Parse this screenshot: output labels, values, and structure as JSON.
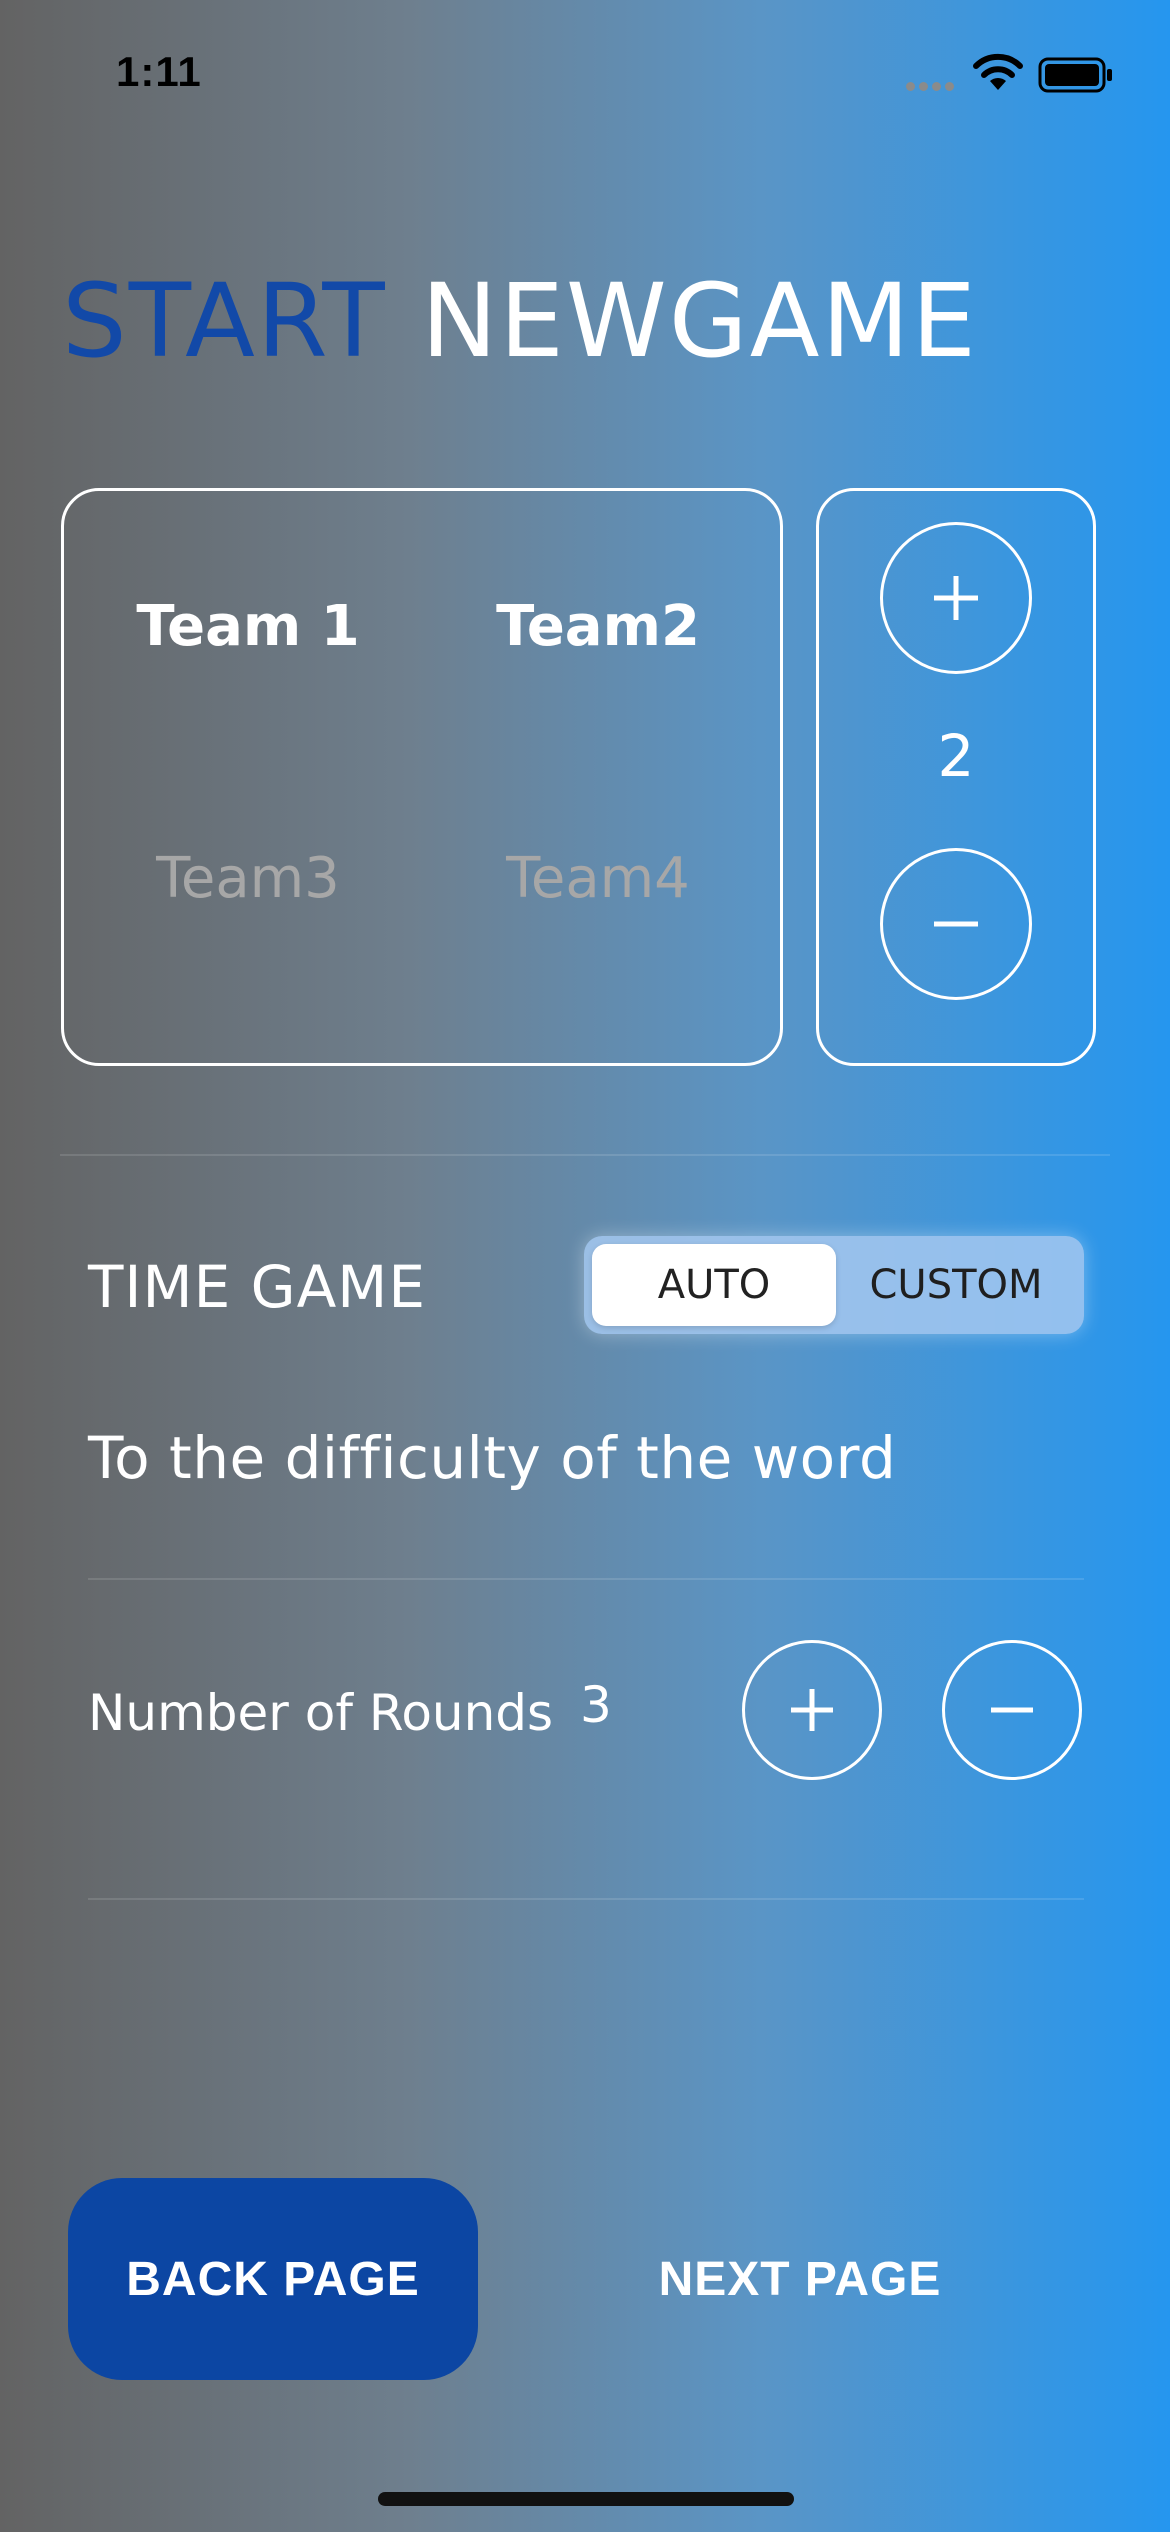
{
  "status_bar": {
    "time": "1:11",
    "icons": [
      "signal-dots-icon",
      "wifi-icon",
      "battery-icon"
    ]
  },
  "title": {
    "start": "START",
    "newgame": "NEWGAME",
    "start_color": "#1249a8",
    "newgame_color": "#ffffff"
  },
  "teams": {
    "items": [
      {
        "label": "Team 1",
        "active": true
      },
      {
        "label": "Team2",
        "active": true
      },
      {
        "label": "Team3",
        "active": false
      },
      {
        "label": "Team4",
        "active": false
      }
    ]
  },
  "team_counter": {
    "value": "2",
    "increment_icon": "plus-icon",
    "decrement_icon": "minus-icon"
  },
  "time_game": {
    "label": "TIME GAME",
    "options": [
      "AUTO",
      "CUSTOM"
    ],
    "selected": "AUTO",
    "description": "To the difficulty of the word"
  },
  "rounds": {
    "label": "Number of Rounds",
    "value": "3",
    "increment_icon": "plus-icon",
    "decrement_icon": "minus-icon"
  },
  "footer": {
    "back_label": "BACK PAGE",
    "next_label": "NEXT PAGE",
    "back_color": "#0c46a3"
  },
  "colors": {
    "gradient_start": "#636363",
    "gradient_end": "#2596ef"
  }
}
